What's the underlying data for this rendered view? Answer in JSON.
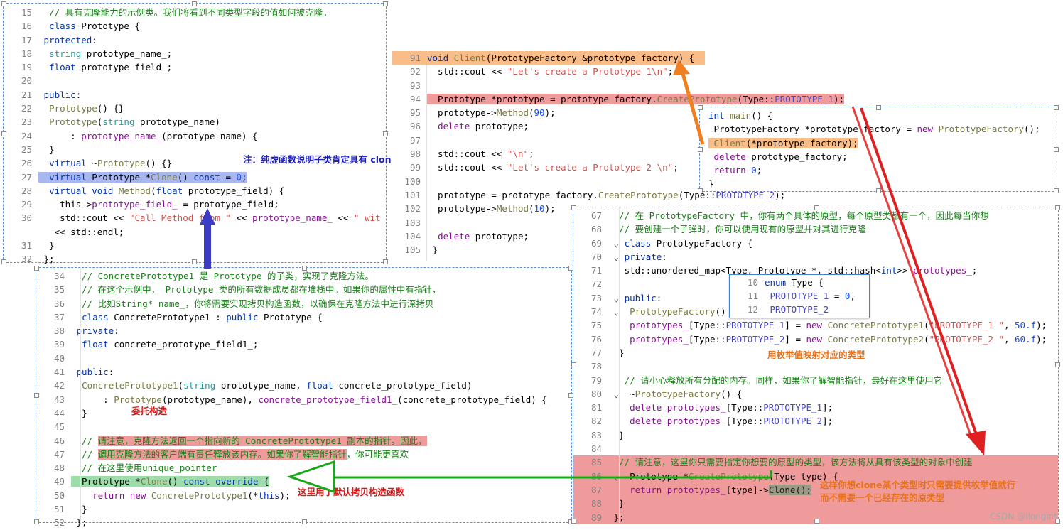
{
  "watermark": "CSDN @llongint",
  "panels": {
    "prototype_class": {
      "name": "Prototype class code block",
      "lines": [
        {
          "n": "15",
          "seg": [
            {
              "t": "  // 具有克隆能力的示例类。我们将看到不同类型字段的值如何被克隆.",
              "c": "cm"
            }
          ]
        },
        {
          "n": "16",
          "seg": [
            {
              "t": "  ",
              "c": "id"
            },
            {
              "t": "class",
              "c": "kw"
            },
            {
              "t": " Prototype {",
              "c": "id"
            }
          ]
        },
        {
          "n": "17",
          "seg": [
            {
              "t": "   ",
              "c": "id"
            },
            {
              "t": "protected",
              "c": "kw"
            },
            {
              "t": ":",
              "c": "id"
            }
          ]
        },
        {
          "n": "18",
          "seg": [
            {
              "t": "    string prototype_name_;",
              "c": "id"
            }
          ]
        },
        {
          "n": "19",
          "seg": [
            {
              "t": "    ",
              "c": "id"
            },
            {
              "t": "float",
              "c": "kw"
            },
            {
              "t": " prototype_field_;",
              "c": "id"
            }
          ]
        },
        {
          "n": "20",
          "seg": [
            {
              "t": "",
              "c": "id"
            }
          ]
        },
        {
          "n": "21",
          "seg": [
            {
              "t": "   ",
              "c": "id"
            },
            {
              "t": "public",
              "c": "kw"
            },
            {
              "t": ":",
              "c": "id"
            }
          ]
        },
        {
          "n": "22",
          "seg": [
            {
              "t": "    Prototype() {}",
              "c": "fn"
            }
          ]
        },
        {
          "n": "23",
          "seg": [
            {
              "t": "    Prototype(string prototype_name)",
              "c": "fn"
            }
          ]
        },
        {
          "n": "24",
          "seg": [
            {
              "t": "          : prototype_name_(prototype_name) {",
              "c": "id"
            }
          ]
        },
        {
          "n": "25",
          "seg": [
            {
              "t": "    }",
              "c": "id"
            }
          ]
        },
        {
          "n": "26",
          "seg": [
            {
              "t": "    ",
              "c": "id"
            },
            {
              "t": "virtual",
              "c": "kw"
            },
            {
              "t": " ~Prototype() {}",
              "c": "id"
            }
          ]
        },
        {
          "n": "27",
          "seg": [
            {
              "t": "    virtual Prototype *Clone() const = 0;",
              "c": "hl"
            }
          ]
        },
        {
          "n": "28",
          "seg": [
            {
              "t": "    ",
              "c": "id"
            },
            {
              "t": "virtual void",
              "c": "kw"
            },
            {
              "t": " Method(",
              "c": "id"
            },
            {
              "t": "float",
              "c": "kw"
            },
            {
              "t": " prototype_field) {",
              "c": "id"
            }
          ]
        },
        {
          "n": "29",
          "seg": [
            {
              "t": "      this->prototype_field_ = prototype_field;",
              "c": "id"
            }
          ]
        },
        {
          "n": "30",
          "seg": [
            {
              "t": "      std::cout << ",
              "c": "id"
            },
            {
              "t": "\"Call Method from \"",
              "c": "str"
            },
            {
              "t": " << prototype_name_ << ",
              "c": "id"
            },
            {
              "t": "\" wit",
              "c": "str"
            }
          ]
        },
        {
          "n": "",
          "seg": [
            {
              "t": "      << std::endl;",
              "c": "id"
            }
          ]
        },
        {
          "n": "31",
          "seg": [
            {
              "t": "    }",
              "c": "id"
            }
          ]
        },
        {
          "n": "32",
          "seg": [
            {
              "t": "  };",
              "c": "id"
            }
          ]
        }
      ],
      "annotation": "注：纯虚函数说明子类肯定具有 clone 功能",
      "highlight_line_text": "virtual Prototype *Clone() const = 0;"
    },
    "client_function": {
      "name": "Client function code block",
      "lines": [
        {
          "n": "91",
          "text": "void Client(PrototypeFactory &prototype_factory) {",
          "hl": "orange"
        },
        {
          "n": "92",
          "text": "   std::cout << \"Let's create a Prototype 1\\n\";"
        },
        {
          "n": "93",
          "text": ""
        },
        {
          "n": "94",
          "text": "   Prototype *prototype = prototype_factory.CreatePrototype(Type::PROTOTYPE_1);",
          "hl": "red"
        },
        {
          "n": "95",
          "text": "   prototype->Method(90);"
        },
        {
          "n": "96",
          "text": "   delete prototype;"
        },
        {
          "n": "97",
          "text": ""
        },
        {
          "n": "98",
          "text": "   std::cout << \"\\n\";"
        },
        {
          "n": "99",
          "text": "   std::cout << \"Let's create a Prototype 2 \\n\";"
        },
        {
          "n": "100",
          "text": ""
        },
        {
          "n": "101",
          "text": "   prototype = prototype_factory.CreatePrototype(Type::PROTOTYPE_2);"
        },
        {
          "n": "102",
          "text": "   prototype->Method(10);"
        },
        {
          "n": "103",
          "text": ""
        },
        {
          "n": "104",
          "text": "   delete prototype;"
        },
        {
          "n": "105",
          "text": " }"
        }
      ]
    },
    "main_function": {
      "name": "main function code block",
      "lines": [
        {
          "n": "",
          "text": "int main() {"
        },
        {
          "n": "",
          "text": "  PrototypeFactory *prototype_factory = new PrototypeFactory();"
        },
        {
          "n": "",
          "text": "  Client(*prototype_factory);",
          "hl": "orange"
        },
        {
          "n": "",
          "text": "  delete prototype_factory;"
        },
        {
          "n": "",
          "text": "  return 0;"
        },
        {
          "n": "",
          "text": " }"
        }
      ]
    },
    "concrete_prototype1": {
      "name": "ConcretePrototype1 code block",
      "lines": [
        {
          "n": "34",
          "text": "  // ConcretePrototype1 是 Prototype 的子类，实现了克隆方法。",
          "kind": "comment"
        },
        {
          "n": "35",
          "text": "  // 在这个示例中， Prototype 类的所有数据成员都在堆栈中。如果你的属性中有指针，",
          "kind": "comment"
        },
        {
          "n": "36",
          "text": "  // 比如String* name_，你将需要实现拷贝构造函数，以确保在克隆方法中进行深拷贝",
          "kind": "comment"
        },
        {
          "n": "37",
          "text": "  class ConcretePrototype1 : public Prototype {"
        },
        {
          "n": "38",
          "text": "   private:"
        },
        {
          "n": "39",
          "text": "    float concrete_prototype_field1_;"
        },
        {
          "n": "40",
          "text": ""
        },
        {
          "n": "41",
          "text": "   public:"
        },
        {
          "n": "42",
          "text": "    ConcretePrototype1(string prototype_name, float concrete_prototype_field)"
        },
        {
          "n": "43",
          "text": "          : Prototype(prototype_name), concrete_prototype_field1_(concrete_prototype_field) {"
        },
        {
          "n": "44",
          "text": "    }"
        },
        {
          "n": "45",
          "text": ""
        },
        {
          "n": "46",
          "text": "    // 请注意，克隆方法返回一个指向新的 ConcretePrototype1 副本的指针。因此，",
          "kind": "comment",
          "hl": "red"
        },
        {
          "n": "47",
          "text": "    // 调用克隆方法的客户端有责任释放该内存。如果你了解智能指针，你可能更喜欢",
          "kind": "comment",
          "hl": "red-partial"
        },
        {
          "n": "48",
          "text": "    // 在这里使用unique_pointer",
          "kind": "comment"
        },
        {
          "n": "49",
          "text": "    Prototype *Clone() const override {",
          "hl": "green"
        },
        {
          "n": "50",
          "text": "        return new ConcretePrototype1(*this);"
        },
        {
          "n": "51",
          "text": "    }"
        },
        {
          "n": "52",
          "text": "  };"
        }
      ],
      "annotations": [
        {
          "text": "委托构造",
          "color": "red",
          "line": 44
        },
        {
          "text": "这里用了默认拷贝构造函数",
          "color": "red",
          "line": 50
        }
      ]
    },
    "prototype_factory": {
      "name": "PrototypeFactory code block",
      "lines": [
        {
          "n": "67",
          "text": "  // 在 PrototypeFactory 中，你有两个具体的原型，每个原型类都有一个，因此每当你想",
          "kind": "comment"
        },
        {
          "n": "68",
          "text": "  // 要创建一个子弹时，你可以使用现有的原型并对其进行克隆",
          "kind": "comment"
        },
        {
          "n": "69",
          "text": "  class PrototypeFactory {"
        },
        {
          "n": "70",
          "text": "   private:"
        },
        {
          "n": "71",
          "text": "    std::unordered_map<Type, Prototype *, std::hash<int>> prototypes_;"
        },
        {
          "n": "72",
          "text": ""
        },
        {
          "n": "73",
          "text": "   public:"
        },
        {
          "n": "74",
          "text": "    PrototypeFactory() {"
        },
        {
          "n": "75",
          "text": "       prototypes_[Type::PROTOTYPE_1] = new ConcretePrototype1(\"PROTOTYPE_1 \", 50.f);"
        },
        {
          "n": "76",
          "text": "       prototypes_[Type::PROTOTYPE_2] = new ConcretePrototype2(\"PROTOTYPE_2 \", 60.f);"
        },
        {
          "n": "77",
          "text": "    }"
        },
        {
          "n": "78",
          "text": ""
        },
        {
          "n": "79",
          "text": "    // 请小心释放所有分配的内存。同样，如果你了解智能指针，最好在这里使用它",
          "kind": "comment"
        },
        {
          "n": "80",
          "text": "    ~PrototypeFactory() {"
        },
        {
          "n": "81",
          "text": "       delete prototypes_[Type::PROTOTYPE_1];"
        },
        {
          "n": "82",
          "text": "       delete prototypes_[Type::PROTOTYPE_2];"
        },
        {
          "n": "83",
          "text": "    }"
        },
        {
          "n": "84",
          "text": ""
        },
        {
          "n": "85",
          "text": "    // 请注意，这里你只需要指定你想要的原型的类型，该方法将从具有该类型的对象中创建",
          "kind": "comment",
          "hl": "red"
        },
        {
          "n": "86",
          "text": "    Prototype *CreatePrototype(Type type) {",
          "hl": "red"
        },
        {
          "n": "87",
          "text": "       return prototypes_[type]->Clone();",
          "hl": "red"
        },
        {
          "n": "88",
          "text": "    }",
          "hl": "red"
        },
        {
          "n": "89",
          "text": "  };",
          "hl": "red"
        }
      ],
      "annotations": [
        {
          "text": "用枚举值映射对应的类型",
          "color": "orange"
        },
        {
          "text": "这样你想clone某个类型时只需要提供枚举值就行",
          "color": "orange"
        },
        {
          "text": "而不需要一个已经存在的原类型",
          "color": "orange"
        }
      ]
    },
    "enum_popup": {
      "name": "enum Type popup",
      "lines": [
        {
          "n": "10",
          "text": "enum Type {"
        },
        {
          "n": "11",
          "text": "  PROTOTYPE_1 = 0,"
        },
        {
          "n": "12",
          "text": "  PROTOTYPE_2"
        }
      ]
    }
  },
  "arrows": [
    {
      "name": "blue-up-arrow",
      "color": "#3b3bc4"
    },
    {
      "name": "orange-arrow-client-to-call",
      "color": "#ef7f1f"
    },
    {
      "name": "red-arrow-create-to-clone",
      "color": "#e02020"
    },
    {
      "name": "green-arrow-clone-to-createprototype",
      "color": "#1aa81a"
    }
  ]
}
